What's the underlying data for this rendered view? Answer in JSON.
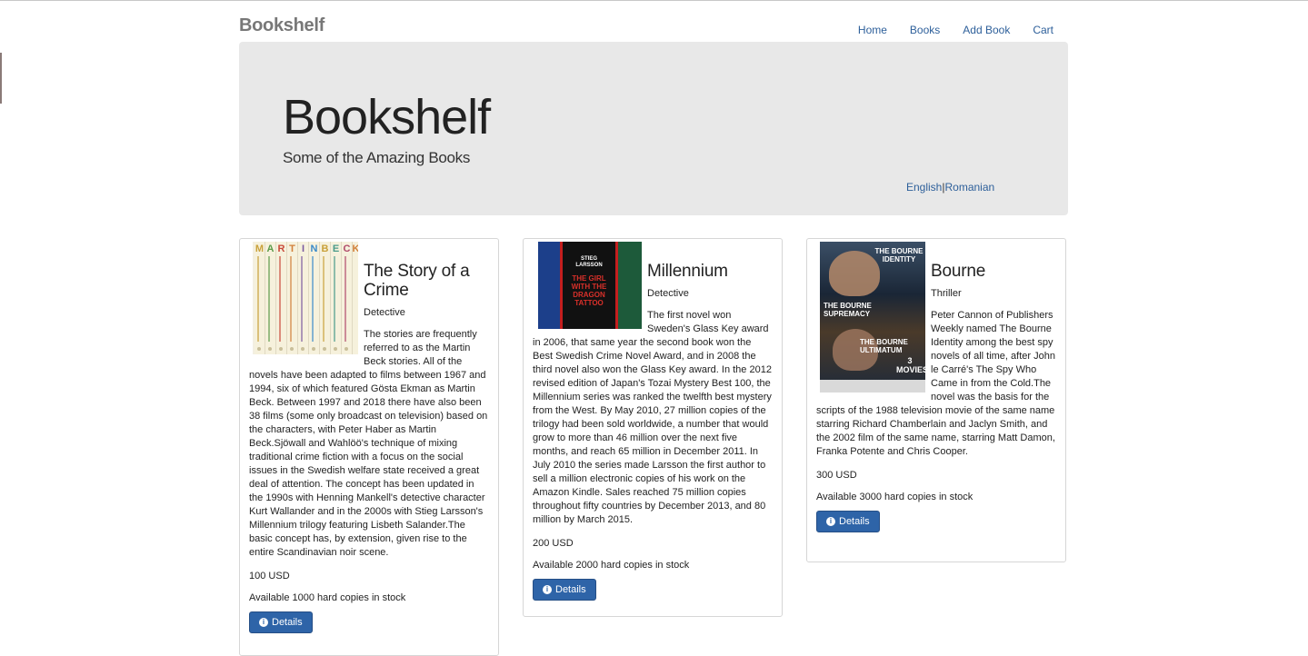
{
  "navbar": {
    "brand": "Bookshelf",
    "links": [
      "Home",
      "Books",
      "Add Book",
      "Cart"
    ]
  },
  "jumbotron": {
    "title": "Bookshelf",
    "subtitle": "Some of the Amazing Books",
    "lang_english": "English",
    "lang_separator": "|",
    "lang_romanian": "Romanian"
  },
  "books": [
    {
      "title": "The Story of a Crime",
      "genre": "Detective",
      "description": "The stories are frequently referred to as the Martin Beck stories. All of the novels have been adapted to films between 1967 and 1994, six of which featured Gösta Ekman as Martin Beck. Between 1997 and 2018 there have also been 38 films (some only broadcast on television) based on the characters, with Peter Haber as Martin Beck.Sjöwall and Wahlöö's technique of mixing traditional crime fiction with a focus on the social issues in the Swedish welfare state received a great deal of attention. The concept has been updated in the 1990s with Henning Mankell's detective character Kurt Wallander and in the 2000s with Stieg Larsson's Millennium trilogy featuring Lisbeth Salander.The basic concept has, by extension, given rise to the entire Scandinavian noir scene.",
      "price": "100 USD",
      "stock": "Available 1000 hard copies in stock",
      "button": "Details",
      "cover_letters": [
        "M",
        "A",
        "R",
        "T",
        "I",
        "N",
        "B",
        "E",
        "C",
        "K"
      ]
    },
    {
      "title": "Millennium",
      "genre": "Detective",
      "description": "The first novel won Sweden's Glass Key award in 2006, that same year the second book won the Best Swedish Crime Novel Award, and in 2008 the third novel also won the Glass Key award. In the 2012 revised edition of Japan's Tozai Mystery Best 100, the Millennium series was ranked the twelfth best mystery from the West. By May 2010, 27 million copies of the trilogy had been sold worldwide, a number that would grow to more than 46 million over the next five months, and reach 65 million in December 2011. In July 2010 the series made Larsson the first author to sell a million electronic copies of his work on the Amazon Kindle. Sales reached 75 million copies throughout fifty countries by December 2013, and 80 million by March 2015.",
      "price": "200 USD",
      "stock": "Available 2000 hard copies in stock",
      "button": "Details",
      "cover_text": [
        "STIEG",
        "LARSSON",
        "THE GIRL",
        "WITH THE",
        "DRAGON",
        "TATTOO"
      ]
    },
    {
      "title": "Bourne",
      "genre": "Thriller",
      "description": "Peter Cannon of Publishers Weekly named The Bourne Identity among the best spy novels of all time, after John le Carré's The Spy Who Came in from the Cold.The novel was the basis for the scripts of the 1988 television movie of the same name starring Richard Chamberlain and Jaclyn Smith, and the 2002 film of the same name, starring Matt Damon, Franka Potente and Chris Cooper.",
      "price": "300 USD",
      "stock": "Available 3000 hard copies in stock",
      "button": "Details",
      "cover_text": [
        "THE BOURNE IDENTITY",
        "THE BOURNE SUPREMACY",
        "THE BOURNE ULTIMATUM",
        "3 MOVIES"
      ]
    }
  ],
  "colors": {
    "link": "#2d5f9a",
    "button": "#2e64a8",
    "jumbotron_bg": "#e8e8e8"
  },
  "icons": {
    "details_button": "info-circle-icon"
  }
}
